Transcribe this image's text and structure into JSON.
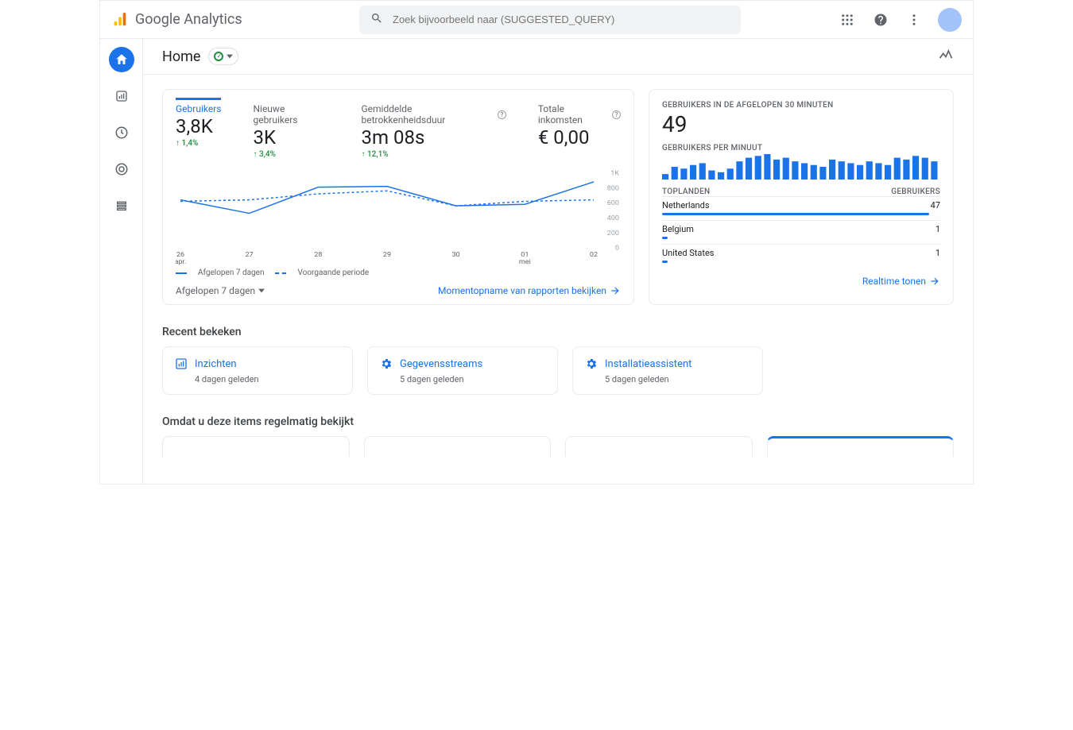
{
  "app": {
    "name": "Google Analytics",
    "search_placeholder": "Zoek bijvoorbeeld naar (SUGGESTED_QUERY)"
  },
  "page": {
    "title": "Home"
  },
  "overview": {
    "metrics": [
      {
        "label": "Gebruikers",
        "value": "3,8K",
        "delta": "↑ 1,4%",
        "active": true,
        "help": false
      },
      {
        "label": "Nieuwe gebruikers",
        "value": "3K",
        "delta": "↑ 3,4%",
        "active": false,
        "help": false
      },
      {
        "label": "Gemiddelde betrokkenheidsduur",
        "value": "3m 08s",
        "delta": "↑ 12,1%",
        "active": false,
        "help": true
      },
      {
        "label": "Totale inkomsten",
        "value": "€ 0,00",
        "delta": "",
        "active": false,
        "help": true
      }
    ],
    "legend": {
      "current": "Afgelopen 7 dagen",
      "previous": "Voorgaande periode"
    },
    "date_range_label": "Afgelopen 7 dagen",
    "footer_link": "Momentopname van rapporten bekijken"
  },
  "chart_data": {
    "type": "line",
    "title": "",
    "xlabel": "",
    "ylabel": "",
    "ylim": [
      0,
      1000
    ],
    "y_ticks": [
      "1K",
      "800",
      "600",
      "400",
      "200",
      "0"
    ],
    "categories": [
      "26 apr.",
      "27",
      "28",
      "29",
      "30",
      "01 mei",
      "02"
    ],
    "series": [
      {
        "name": "Afgelopen 7 dagen",
        "style": "solid",
        "values": [
          640,
          460,
          810,
          820,
          560,
          580,
          880
        ]
      },
      {
        "name": "Voorgaande periode",
        "style": "dashed",
        "values": [
          620,
          640,
          720,
          760,
          560,
          620,
          640
        ]
      }
    ]
  },
  "realtime": {
    "title": "GEBRUIKERS IN DE AFGELOPEN 30 MINUTEN",
    "value": "49",
    "subtitle": "GEBRUIKERS PER MINUUT",
    "bars": [
      3,
      7,
      6,
      8,
      9,
      5,
      4,
      6,
      10,
      12,
      13,
      14,
      11,
      12,
      10,
      9,
      8,
      7,
      11,
      10,
      9,
      8,
      10,
      9,
      8,
      12,
      11,
      13,
      12,
      10
    ],
    "columns": {
      "left": "TOPLANDEN",
      "right": "GEBRUIKERS"
    },
    "rows": [
      {
        "country": "Netherlands",
        "value": "47",
        "pct": 96
      },
      {
        "country": "Belgium",
        "value": "1",
        "pct": 2
      },
      {
        "country": "United States",
        "value": "1",
        "pct": 2
      }
    ],
    "footer_link": "Realtime tonen"
  },
  "recent": {
    "title": "Recent bekeken",
    "items": [
      {
        "icon": "insights",
        "label": "Inzichten",
        "sub": "4 dagen geleden"
      },
      {
        "icon": "gear",
        "label": "Gegevensstreams",
        "sub": "5 dagen geleden"
      },
      {
        "icon": "gear",
        "label": "Installatieassistent",
        "sub": "5 dagen geleden"
      }
    ]
  },
  "because": {
    "title": "Omdat u deze items regelmatig bekijkt"
  }
}
